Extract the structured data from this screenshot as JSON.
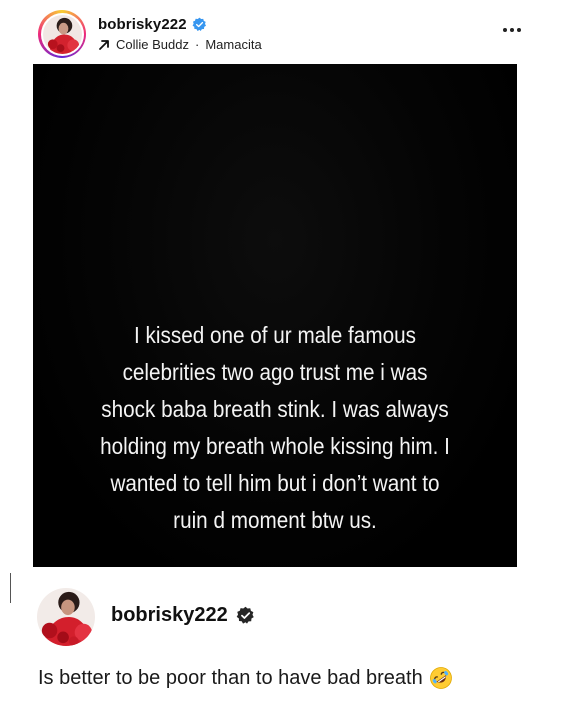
{
  "post": {
    "username": "bobrisky222",
    "music": {
      "artist": "Collie Buddz",
      "separator": "·",
      "song": "Mamacita"
    },
    "more_label": "More options"
  },
  "media": {
    "caption_lines": [
      "I kissed one of ur male famous",
      "celebrities two ago trust me i was",
      "shock baba breath stink. I was always",
      "holding my breath whole kissing him. I",
      "wanted to tell him but i don’t want to",
      "ruin d moment btw us."
    ]
  },
  "comment": {
    "username": "bobrisky222",
    "text": "Is better to be poor than to have bad breath",
    "emoji": "rolling-on-the-floor-laughing-icon"
  },
  "colors": {
    "verified_blue": "#3897f0",
    "verified_dark": "#262626",
    "media_background": "#000000",
    "caption_text": "#f4f4f4"
  }
}
